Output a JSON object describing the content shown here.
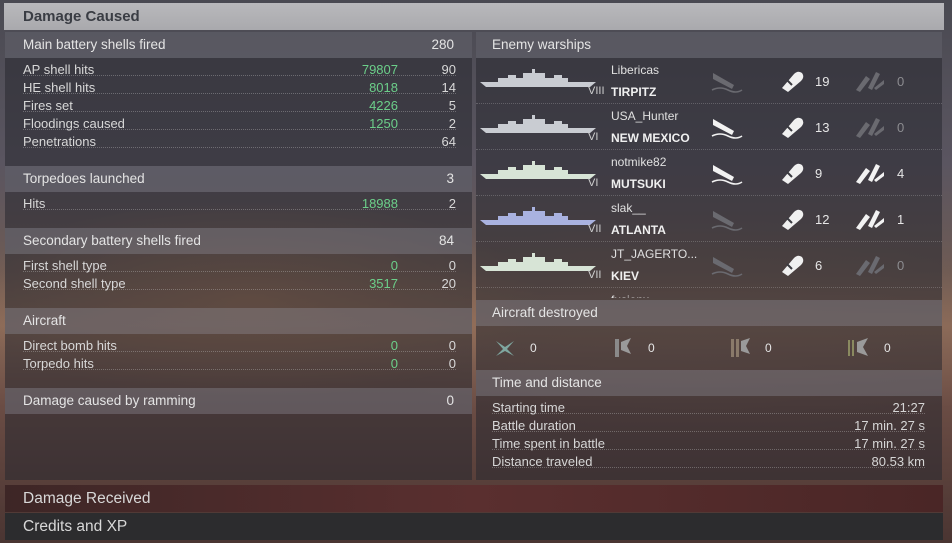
{
  "header": {
    "title": "Damage Caused"
  },
  "main_battery": {
    "title": "Main battery shells fired",
    "total": "280",
    "rows": [
      {
        "label": "AP shell hits",
        "damage": "79807",
        "count": "90"
      },
      {
        "label": "HE shell hits",
        "damage": "8018",
        "count": "14"
      },
      {
        "label": "Fires set",
        "damage": "4226",
        "count": "5"
      },
      {
        "label": "Floodings caused",
        "damage": "1250",
        "count": "2"
      },
      {
        "label": "Penetrations",
        "damage": "",
        "count": "64"
      }
    ]
  },
  "torpedoes": {
    "title": "Torpedoes launched",
    "total": "3",
    "rows": [
      {
        "label": "Hits",
        "damage": "18988",
        "count": "2"
      }
    ]
  },
  "secondary": {
    "title": "Secondary battery shells fired",
    "total": "84",
    "rows": [
      {
        "label": "First shell type",
        "damage": "0",
        "count": "0"
      },
      {
        "label": "Second shell type",
        "damage": "3517",
        "count": "20"
      }
    ]
  },
  "aircraft": {
    "title": "Aircraft",
    "rows": [
      {
        "label": "Direct bomb hits",
        "damage": "0",
        "count": "0"
      },
      {
        "label": "Torpedo hits",
        "damage": "0",
        "count": "0"
      }
    ]
  },
  "ramming": {
    "title": "Damage caused by ramming",
    "total": "0"
  },
  "enemy_warships": {
    "title": "Enemy warships",
    "ships": [
      {
        "player": "Libericas",
        "ship": "TIRPITZ",
        "tier": "VIII",
        "shells": "19",
        "torps": "0",
        "sink_active": false,
        "torp_active": false,
        "color": "#c9ccd2"
      },
      {
        "player": "USA_Hunter",
        "ship": "NEW MEXICO",
        "tier": "VI",
        "shells": "13",
        "torps": "0",
        "sink_active": true,
        "torp_active": false,
        "color": "#c9ccd2"
      },
      {
        "player": "notmike82",
        "ship": "MUTSUKI",
        "tier": "VI",
        "shells": "9",
        "torps": "4",
        "sink_active": true,
        "torp_active": true,
        "color": "#d7e4d6"
      },
      {
        "player": "slak__",
        "ship": "ATLANTA",
        "tier": "VII",
        "shells": "12",
        "torps": "1",
        "sink_active": false,
        "torp_active": true,
        "color": "#a9b2e0"
      },
      {
        "player": "JT_JAGERTO...",
        "ship": "KIEV",
        "tier": "VII",
        "shells": "6",
        "torps": "0",
        "sink_active": false,
        "torp_active": false,
        "color": "#d7e4d6"
      }
    ],
    "partial_player": "fusionx"
  },
  "aircraft_destroyed": {
    "title": "Aircraft destroyed",
    "items": [
      {
        "icon": "fighter-icon",
        "count": "0"
      },
      {
        "icon": "dive-bomber-icon",
        "count": "0"
      },
      {
        "icon": "torpedo-bomber-icon",
        "count": "0"
      },
      {
        "icon": "spotter-plane-icon",
        "count": "0"
      }
    ]
  },
  "time_distance": {
    "title": "Time and distance",
    "rows": [
      {
        "label": "Starting time",
        "value": "21:27"
      },
      {
        "label": "Battle duration",
        "value": "17 min. 27 s"
      },
      {
        "label": "Time spent in battle",
        "value": "17 min. 27 s"
      },
      {
        "label": "Distance traveled",
        "value": "80.53 km"
      }
    ]
  },
  "footer": {
    "damage_received": "Damage Received",
    "credits_xp": "Credits and XP"
  },
  "colors": {
    "green_value": "#6ccf8a",
    "header_bg": "#b3b3b7",
    "received_bg": "#4a2a2a"
  }
}
